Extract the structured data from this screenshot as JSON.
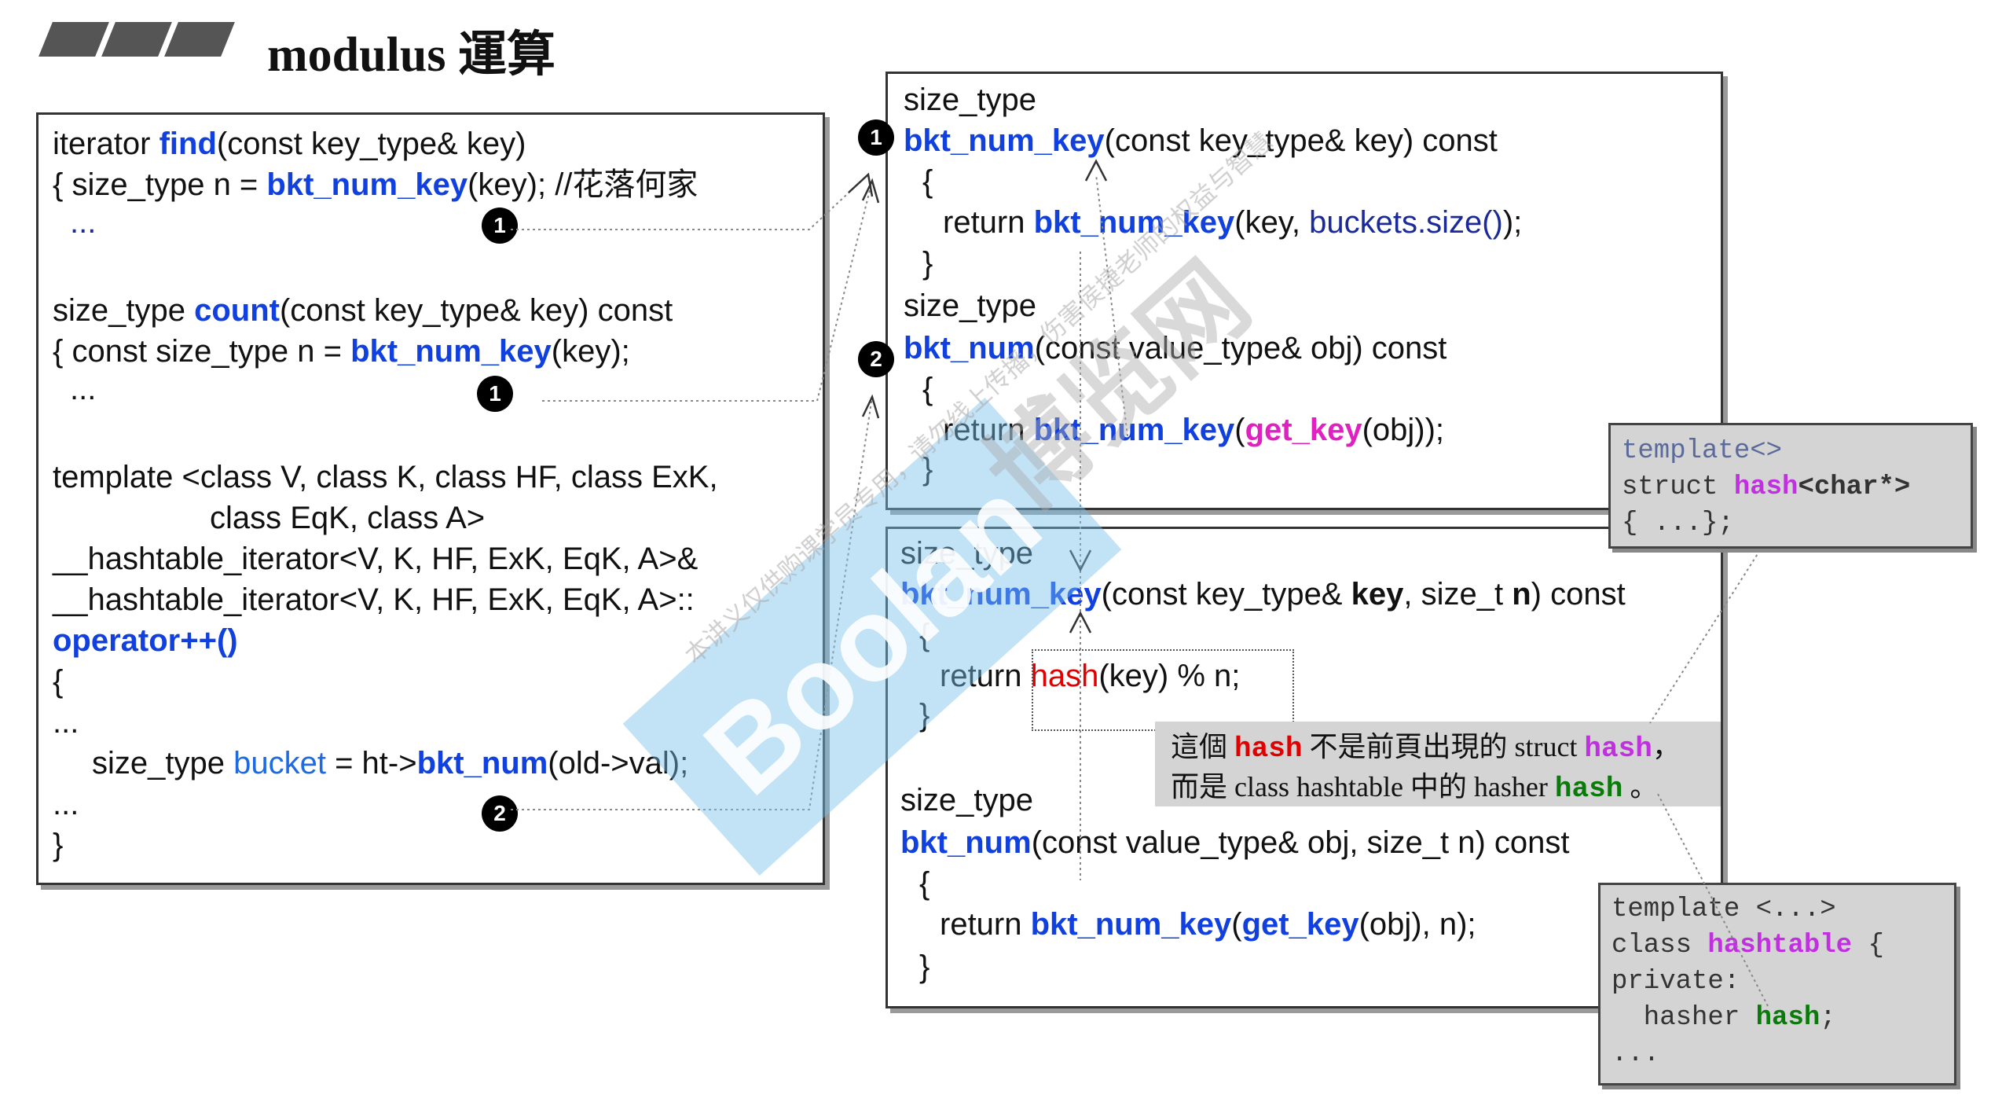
{
  "title": "modulus 運算",
  "left_panel": {
    "find_l1_a": "iterator ",
    "find_l1_fn": "find",
    "find_l1_b": "(const key_type& key)",
    "find_l2_a": "{ size_type n = ",
    "find_l2_fn": "bkt_num_key",
    "find_l2_b": "(key); //花落何家",
    "find_l3": "...",
    "count_l1_a": "size_type ",
    "count_l1_fn": "count",
    "count_l1_b": "(const key_type& key) const",
    "count_l2_a": "{ const size_type n = ",
    "count_l2_fn": "bkt_num_key",
    "count_l2_b": "(key);",
    "count_l3": "...",
    "tmpl_l1": "template <class V, class K, class HF, class ExK,",
    "tmpl_l2": "class EqK, class A>",
    "tmpl_l3": "__hashtable_iterator<V, K, HF, ExK, EqK, A>&",
    "tmpl_l4": "__hashtable_iterator<V, K, HF, ExK, EqK, A>::",
    "tmpl_l5": "operator++()",
    "tmpl_l6": "{",
    "tmpl_l7": "...",
    "tmpl_l8_a": "size_type ",
    "tmpl_l8_var": "bucket",
    "tmpl_l8_b": " = ht->",
    "tmpl_l8_fn": "bkt_num",
    "tmpl_l8_c": "(old->val);",
    "tmpl_l9": "...",
    "tmpl_l10": "}"
  },
  "top_right_panel": {
    "l1": "size_type",
    "l2_fn": "bkt_num_key",
    "l2_b": "(const key_type& key) const",
    "l3": "{",
    "l4_a": "return ",
    "l4_fn": "bkt_num_key",
    "l4_b": "(key, ",
    "l4_c": "buckets.size()",
    "l4_d": ");",
    "l5": "}",
    "l6": "size_type",
    "l7_fn": "bkt_num",
    "l7_b": "(const value_type& obj) const",
    "l8": "{",
    "l9_a": "return ",
    "l9_fn": "bkt_num_key",
    "l9_b": "(",
    "l9_c": "get_key",
    "l9_d": "(obj));",
    "l10": "}"
  },
  "bottom_right_panel": {
    "l1": "size_type",
    "l2_fn": "bkt_num_key",
    "l2_b": "(const key_type& ",
    "l2_key": "key",
    "l2_c": ", size_t ",
    "l2_n": "n",
    "l2_d": ") const",
    "l3": "{",
    "l4_a": "return ",
    "l4_fn": "hash",
    "l4_b": "(key) % n;",
    "l5": "}",
    "l6": "size_type",
    "l7_fn": "bkt_num",
    "l7_b": "(const value_type& obj, size_t n) const",
    "l8": "{",
    "l9_a": "return ",
    "l9_fn": "bkt_num_key",
    "l9_b": "(",
    "l9_c": "get_key",
    "l9_d": "(obj), n);",
    "l10": "}"
  },
  "badges": {
    "one": "1",
    "two": "2"
  },
  "hash_char_box": {
    "l1": "template<>",
    "l2_a": "struct ",
    "l2_kw": "hash",
    "l2_b": "<char*>",
    "l3": "{ ...};"
  },
  "hashtable_box": {
    "l1": "template <...>",
    "l2_a": "class ",
    "l2_kw": "hashtable",
    "l2_b": " {",
    "l3": "private:",
    "l4_a": "  hasher ",
    "l4_kw": "hash",
    "l4_b": ";",
    "l5": "..."
  },
  "note": {
    "l1_a": "這個 ",
    "l1_kw1": "hash",
    "l1_b": " 不是前頁出現的 struct ",
    "l1_kw2": "hash",
    "l1_c": "，",
    "l2_a": "而是 class hashtable 中的 hasher ",
    "l2_kw": "hash",
    "l2_b": " 。"
  },
  "watermark": {
    "logo": "Boolan",
    "cn": "博览网",
    "small": "本讲义仅供购课学员专用，请勿线上传播，伤害侯捷老师的权益与智慧"
  },
  "colors": {
    "fn_blue": "#1040e0",
    "red": "#e00000",
    "magenta": "#e020c0",
    "green": "#0a7a0a",
    "panel_border": "#333333",
    "gray_box": "#d4d4d4"
  }
}
